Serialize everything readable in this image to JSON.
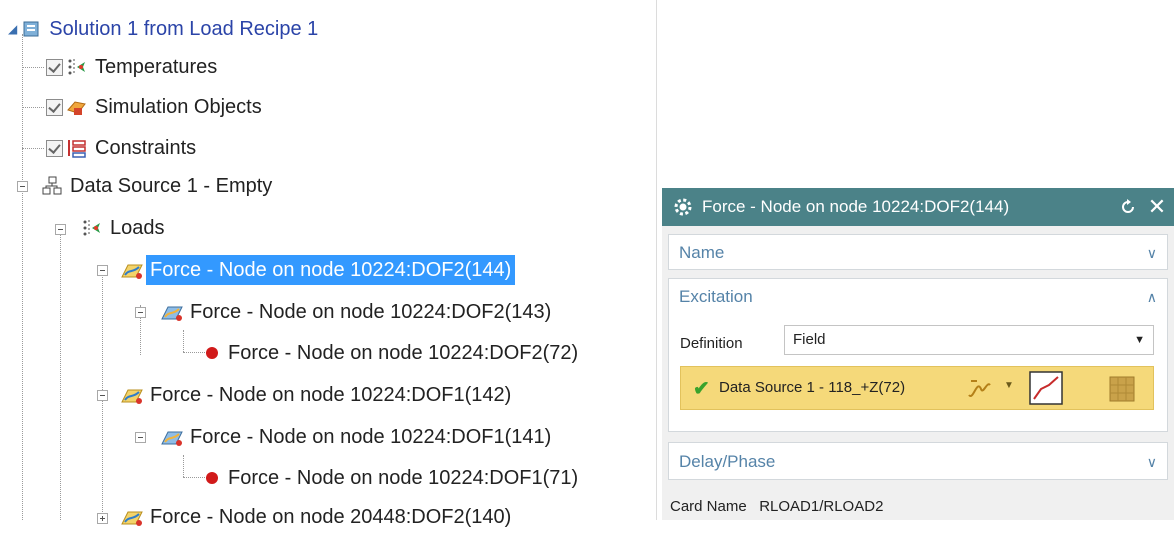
{
  "tree": {
    "root": {
      "label": "Solution 1 from Load Recipe 1"
    },
    "items": [
      {
        "label": "Temperatures"
      },
      {
        "label": "Simulation Objects"
      },
      {
        "label": "Constraints"
      },
      {
        "label": "Data Source 1 - Empty"
      },
      {
        "label": "Loads"
      },
      {
        "label": "Force - Node on node 10224:DOF2(144)",
        "selected": true
      },
      {
        "label": "Force - Node on node 10224:DOF2(143)"
      },
      {
        "label": "Force - Node on node 10224:DOF2(72)"
      },
      {
        "label": "Force - Node on node 10224:DOF1(142)"
      },
      {
        "label": "Force - Node on node 10224:DOF1(141)"
      },
      {
        "label": "Force - Node on node 10224:DOF1(71)"
      },
      {
        "label": "Force - Node on node 20448:DOF2(140)"
      }
    ]
  },
  "dialog": {
    "title": "Force - Node on node 10224:DOF2(144)",
    "sections": {
      "name": {
        "label": "Name",
        "expanded": false
      },
      "excitation": {
        "label": "Excitation",
        "expanded": true,
        "definition_label": "Definition",
        "definition_value": "Field",
        "data_source": "Data Source 1 - 118_+Z(72)"
      },
      "delay": {
        "label": "Delay/Phase",
        "expanded": false
      }
    },
    "card_name": "Card Name   RLOAD1/RLOAD2"
  },
  "colors": {
    "titlebar": "#4b8288",
    "selection": "#3399ff",
    "root_text": "#2b44a8",
    "section_header": "#5583a8",
    "data_source_bg": "#f5d97a"
  },
  "icons": {
    "titlebar": [
      "gear-icon",
      "reset-icon",
      "close-icon"
    ],
    "tree": [
      "solution-icon",
      "temperature-icon",
      "simulation-objects-icon",
      "constraints-icon",
      "data-source-icon",
      "loads-icon",
      "force-icon",
      "force-group-icon",
      "error-dot-icon"
    ],
    "excitation": [
      "checkmark-icon",
      "formula-icon",
      "dropdown-arrow-icon",
      "plot-icon",
      "table-icon"
    ]
  }
}
